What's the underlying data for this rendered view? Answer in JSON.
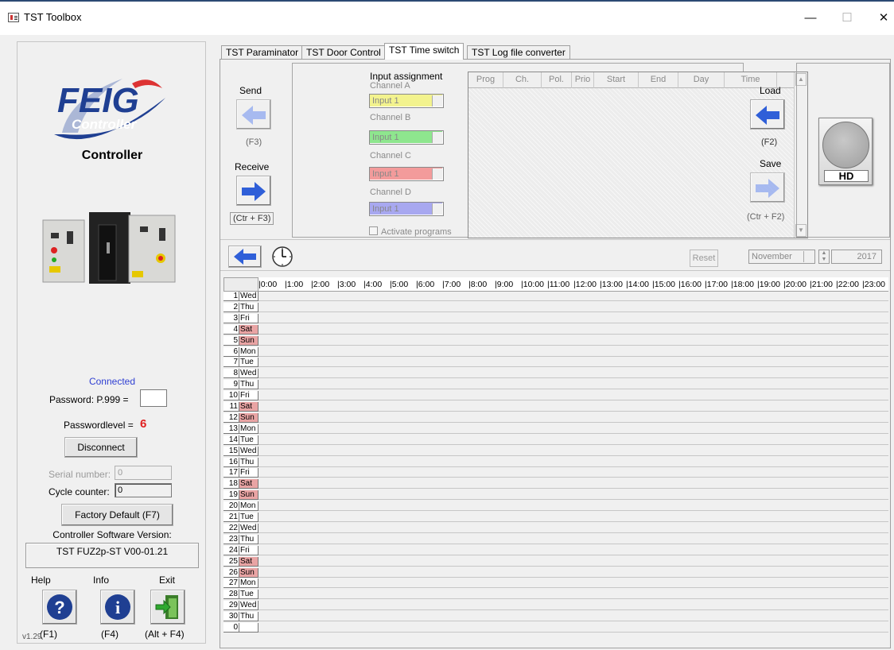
{
  "window": {
    "title": "TST Toolbox",
    "minimize_glyph": "—",
    "maximize_glyph": "☐",
    "close_glyph": "✕"
  },
  "left": {
    "brand_line1": "FEIG",
    "brand_line2": "Controller",
    "device_title": "Controller",
    "status": "Connected",
    "password_label": "Password: P.999 =",
    "password_value": "",
    "passwordlevel_label": "Passwordlevel =",
    "passwordlevel_value": "6",
    "disconnect_label": "Disconnect",
    "serial_label": "Serial number:",
    "serial_value": "0",
    "cycle_label": "Cycle counter:",
    "cycle_value": "0",
    "factory_label": "Factory Default (F7)",
    "sw_version_label": "Controller Software Version:",
    "sw_version_value": "TST FUZ2p-ST V00-01.21",
    "help_label": "Help",
    "info_label": "Info",
    "exit_label": "Exit",
    "help_key": "(F1)",
    "info_key": "(F4)",
    "exit_key": "(Alt + F4)",
    "app_version": "v1.29"
  },
  "tabs": [
    {
      "label": "TST Paraminator",
      "active": false
    },
    {
      "label": "TST Door Control",
      "active": false
    },
    {
      "label": "TST Time switch",
      "active": true
    },
    {
      "label": "TST Log file converter",
      "active": false
    }
  ],
  "timeswitch": {
    "send_label": "Send",
    "send_key": "(F3)",
    "receive_label": "Receive",
    "receive_key": "(Ctr + F3)",
    "input_assignment_title": "Input assignment",
    "channels": [
      {
        "label": "Channel A",
        "value": "Input 1",
        "color": "#f3f38e"
      },
      {
        "label": "Channel B",
        "value": "Input 1",
        "color": "#8ee68e"
      },
      {
        "label": "Channel C",
        "value": "Input 1",
        "color": "#f39b9b"
      },
      {
        "label": "Channel D",
        "value": "Input 1",
        "color": "#a8a8f0"
      }
    ],
    "activate_programs_label": "Activate programs",
    "program_columns": [
      "Prog",
      "Ch.",
      "Pol.",
      "Prio",
      "Start",
      "End",
      "Day",
      "Time"
    ],
    "load_label": "Load",
    "load_key": "(F2)",
    "save_label": "Save",
    "save_key": "(Ctr + F2)",
    "hd_label": "HD",
    "reset_label": "Reset",
    "month": "November",
    "year": "2017"
  },
  "calendar": {
    "hours": [
      "0:00",
      "1:00",
      "2:00",
      "3:00",
      "4:00",
      "5:00",
      "6:00",
      "7:00",
      "8:00",
      "9:00",
      "10:00",
      "11:00",
      "12:00",
      "13:00",
      "14:00",
      "15:00",
      "16:00",
      "17:00",
      "18:00",
      "19:00",
      "20:00",
      "21:00",
      "22:00",
      "23:00"
    ],
    "days": [
      {
        "num": "1",
        "name": "Wed",
        "weekend": false
      },
      {
        "num": "2",
        "name": "Thu",
        "weekend": false
      },
      {
        "num": "3",
        "name": "Fri",
        "weekend": false
      },
      {
        "num": "4",
        "name": "Sat",
        "weekend": true
      },
      {
        "num": "5",
        "name": "Sun",
        "weekend": true
      },
      {
        "num": "6",
        "name": "Mon",
        "weekend": false
      },
      {
        "num": "7",
        "name": "Tue",
        "weekend": false
      },
      {
        "num": "8",
        "name": "Wed",
        "weekend": false
      },
      {
        "num": "9",
        "name": "Thu",
        "weekend": false
      },
      {
        "num": "10",
        "name": "Fri",
        "weekend": false
      },
      {
        "num": "11",
        "name": "Sat",
        "weekend": true
      },
      {
        "num": "12",
        "name": "Sun",
        "weekend": true
      },
      {
        "num": "13",
        "name": "Mon",
        "weekend": false
      },
      {
        "num": "14",
        "name": "Tue",
        "weekend": false
      },
      {
        "num": "15",
        "name": "Wed",
        "weekend": false
      },
      {
        "num": "16",
        "name": "Thu",
        "weekend": false
      },
      {
        "num": "17",
        "name": "Fri",
        "weekend": false
      },
      {
        "num": "18",
        "name": "Sat",
        "weekend": true
      },
      {
        "num": "19",
        "name": "Sun",
        "weekend": true
      },
      {
        "num": "20",
        "name": "Mon",
        "weekend": false
      },
      {
        "num": "21",
        "name": "Tue",
        "weekend": false
      },
      {
        "num": "22",
        "name": "Wed",
        "weekend": false
      },
      {
        "num": "23",
        "name": "Thu",
        "weekend": false
      },
      {
        "num": "24",
        "name": "Fri",
        "weekend": false
      },
      {
        "num": "25",
        "name": "Sat",
        "weekend": true
      },
      {
        "num": "26",
        "name": "Sun",
        "weekend": true
      },
      {
        "num": "27",
        "name": "Mon",
        "weekend": false
      },
      {
        "num": "28",
        "name": "Tue",
        "weekend": false
      },
      {
        "num": "29",
        "name": "Wed",
        "weekend": false
      },
      {
        "num": "30",
        "name": "Thu",
        "weekend": false
      },
      {
        "num": "0",
        "name": "",
        "weekend": false
      }
    ]
  },
  "colors": {
    "accent_blue": "#2f5fd8",
    "status_blue": "#2f3fd2",
    "level_red": "#e02020",
    "weekend_pink": "#e9a4a4"
  }
}
